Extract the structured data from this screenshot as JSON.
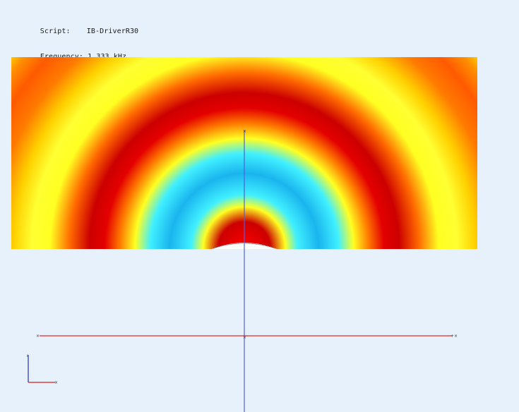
{
  "info": {
    "script_label": "Script:",
    "script_value": "IB-DriverR30",
    "frequency_label": "Frequency:",
    "frequency_value": "1.333 kHz"
  },
  "axes": {
    "vertical_axis_color": "#5560d8",
    "horizontal_axis_color": "#e02a2a",
    "left_end_marker": "×",
    "right_end_marker": "+×",
    "origin_x_marker": "×"
  },
  "field_plot": {
    "colormap": [
      "#ff0000",
      "#ff8c00",
      "#ffff22",
      "#30e6ff",
      "#0aa5e8"
    ],
    "colormap_name": "pressure-magnitude"
  },
  "triad": {
    "x_color": "#d02020",
    "y_color": "#2030c0"
  }
}
